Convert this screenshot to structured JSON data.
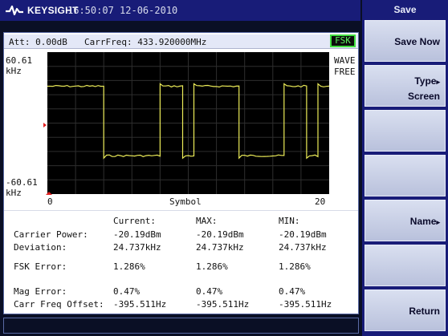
{
  "header": {
    "brand": "KEYSIGHT",
    "datetime": "16:50:07  12-06-2010"
  },
  "info_bar": {
    "attenuation": "Att: 0.00dB",
    "carrier_freq": "CarrFreq: 433.920000MHz",
    "mode_badge": "FSK"
  },
  "plot": {
    "y_top": "60.61",
    "y_top_unit": "kHz",
    "y_bottom": "-60.61",
    "y_bottom_unit": "kHz",
    "trace_mode_1": "WAVE",
    "trace_mode_2": "FREE",
    "x_min": "0",
    "x_label": "Symbol",
    "x_max": "20",
    "trace_color": "#ecec58",
    "symbols": [
      1,
      1,
      1,
      1,
      1,
      0,
      0,
      0,
      0,
      0,
      1,
      1,
      0,
      1,
      1,
      1,
      1,
      0,
      0,
      0,
      0,
      1,
      1,
      0,
      1
    ]
  },
  "table": {
    "headers": [
      "Current:",
      "MAX:",
      "MIN:"
    ],
    "rows": [
      {
        "label": "Carrier Power:",
        "current": "-20.19dBm",
        "max": "-20.19dBm",
        "min": "-20.19dBm"
      },
      {
        "label": "Deviation:",
        "current": "24.737kHz",
        "max": "24.737kHz",
        "min": "24.737kHz"
      },
      {
        "label": "FSK Error:",
        "current": "1.286%",
        "max": "1.286%",
        "min": "1.286%"
      },
      {
        "label": "Mag Error:",
        "current": "0.47%",
        "max": "0.47%",
        "min": "0.47%"
      },
      {
        "label": "Carr Freq Offset:",
        "current": "-395.511Hz",
        "max": "-395.511Hz",
        "min": "-395.511Hz"
      }
    ]
  },
  "softkeys": {
    "menu_title": "Save",
    "save_now": "Save Now",
    "type_line1": "Type",
    "type_line2": "Screen",
    "name": "Name",
    "return": "Return",
    "arrow_glyph": "▸"
  }
}
